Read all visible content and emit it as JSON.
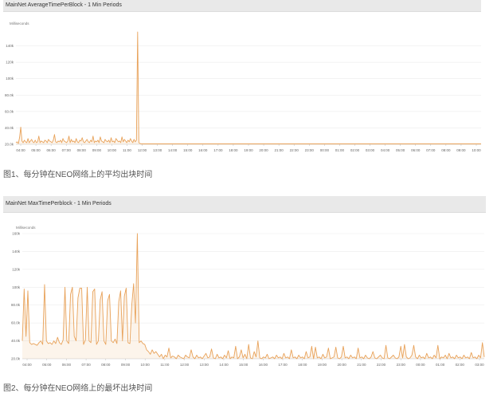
{
  "chart_data": [
    {
      "type": "line",
      "title": "MainNet AverageTimePerBlock - 1 Min Periods",
      "ylabel": "Milliseconds",
      "xlabel": "",
      "ylim": [
        20000,
        160000
      ],
      "yticks": [
        "20.0k",
        "40.0k",
        "60.0k",
        "80.0k",
        "100k",
        "120k",
        "140k"
      ],
      "x": [
        "04:00",
        "05:00",
        "06:00",
        "07:00",
        "08:00",
        "09:00",
        "10:00",
        "11:00",
        "12:00",
        "13:00",
        "14:00",
        "15:00",
        "16:00",
        "17:00",
        "18:00",
        "19:00",
        "20:00",
        "21:00",
        "22:00",
        "23:00",
        "00:00",
        "01:00",
        "02:00",
        "03:00",
        "04:00",
        "05:00",
        "06:00",
        "07:00",
        "08:00",
        "09:00",
        "10:00"
      ],
      "grid": true,
      "color": "#e8a25a",
      "series": [
        {
          "values": [
            22000,
            23000,
            21000,
            28000,
            41000,
            24000,
            22000,
            25000,
            23000,
            22000,
            27000,
            22000,
            24000,
            26000,
            23000,
            22000,
            25000,
            22000,
            23000,
            30000,
            22000,
            24000,
            23000,
            22000,
            25000,
            24000,
            22000,
            26000,
            24000,
            23000,
            22000,
            25000,
            32000,
            23000,
            22000,
            24000,
            23000,
            25000,
            22000,
            27000,
            24000,
            23000,
            22000,
            24000,
            30000,
            22000,
            26000,
            23000,
            24000,
            22000,
            27000,
            23000,
            22000,
            25000,
            24000,
            28000,
            23000,
            22000,
            24000,
            26000,
            23000,
            22000,
            25000,
            23000,
            30000,
            22000,
            24000,
            23000,
            25000,
            22000,
            29000,
            24000,
            23000,
            22000,
            26000,
            24000,
            23000,
            25000,
            22000,
            28000,
            23000,
            24000,
            22000,
            27000,
            25000,
            23000,
            24000,
            22000,
            29000,
            23000,
            26000,
            24000,
            22000,
            25000,
            23000,
            27000,
            24000,
            22000,
            26000,
            23000,
            25000,
            157000,
            22000,
            21000,
            20500,
            20500,
            20500,
            20500,
            20500,
            20500,
            20500,
            20500,
            20500,
            20500,
            20500,
            20500,
            20500,
            20500,
            20500,
            20500,
            20500,
            20500,
            20500,
            20500,
            20500,
            20500,
            20500,
            20500,
            20500,
            20500,
            20500,
            20500,
            20500,
            20500,
            20500,
            20500,
            20500,
            20500,
            20500,
            20500,
            20500,
            20500,
            20500,
            20500,
            20500,
            20500,
            20500,
            20500,
            20500,
            20500,
            20500,
            20500,
            20500,
            20500,
            20500,
            20500,
            20500,
            20500,
            20500,
            20500,
            20500,
            20500,
            20500,
            20500,
            20500,
            20500,
            20500,
            20500,
            20500,
            20500,
            20500,
            20500,
            20500,
            20500,
            20500,
            20500,
            20500,
            20500,
            20500,
            20500,
            20500,
            20500,
            20500,
            20500,
            20500,
            20500,
            20500,
            20500,
            20500,
            20500,
            20500,
            20500,
            20500,
            20500,
            20500,
            20500,
            20500,
            20500,
            20500,
            20500,
            20500,
            20500,
            20500,
            20500,
            20500,
            20500,
            20500,
            20500,
            20500,
            20500,
            20500,
            20500,
            20500,
            20500,
            20500,
            20500,
            20500,
            20500,
            20500,
            20500,
            20500,
            20500,
            20500,
            20500,
            20500,
            20500,
            20500,
            20500,
            20500,
            20500,
            20500,
            20500,
            20500,
            20500,
            20500,
            20500,
            20500,
            20500,
            20500,
            20500,
            20500,
            20500,
            20500,
            20500,
            20500,
            20500,
            20500,
            20500,
            20500,
            20500,
            20500,
            20500,
            20500,
            20500,
            20500,
            20500,
            20500,
            20500,
            20500,
            20500,
            20500,
            20500,
            20500,
            20500,
            20500,
            20500,
            20500,
            20500,
            20500,
            20500,
            20500,
            20500,
            20500,
            20500,
            20500,
            20500,
            20500,
            20500,
            20500,
            20500,
            20500,
            20500,
            20500,
            20500,
            20500,
            20500,
            20500,
            20500,
            20500,
            20500,
            20500,
            20500,
            20500,
            20500,
            20500,
            20500,
            20500,
            20500,
            20500,
            20500,
            20500,
            20500,
            20500,
            20500,
            20500,
            20500,
            20500,
            20500,
            20500,
            20500,
            20500,
            20500,
            20500,
            20500,
            20500,
            20500,
            20500,
            20500,
            20500,
            20500,
            20500,
            20500,
            20500,
            20500,
            20500,
            20500,
            20500,
            20500,
            20500,
            20500,
            20500,
            20500,
            20500,
            20500,
            20500,
            20500,
            20500,
            20500,
            20500,
            20500,
            20500,
            20500,
            20500,
            20500,
            20500,
            20500,
            20500,
            20500,
            20500,
            20500,
            20500,
            20500,
            20500,
            20500,
            20500,
            20500,
            20500,
            20500,
            20500,
            20500,
            20500,
            20500,
            20500,
            20500,
            20500,
            20500,
            20500,
            20500,
            20500,
            20500,
            20500,
            20500,
            20500,
            20500,
            20500,
            20500,
            20500,
            20500,
            20500,
            20500,
            20500,
            20500,
            20500,
            20500,
            20500,
            20500,
            20500
          ]
        }
      ],
      "caption": "图1、每分钟在NEO网络上的平均出块时间"
    },
    {
      "type": "line",
      "title": "MainNet MaxTimePerblock - 1 Min Periods",
      "ylabel": "Milliseconds",
      "xlabel": "",
      "ylim": [
        20000,
        160000
      ],
      "yticks": [
        "20.0k",
        "40.0k",
        "60.0k",
        "80.0k",
        "100k",
        "120k",
        "140k",
        "160k"
      ],
      "x": [
        "04:00",
        "05:00",
        "06:00",
        "07:00",
        "08:00",
        "09:00",
        "10:00",
        "11:00",
        "12:00",
        "13:00",
        "14:00",
        "15:00",
        "16:00",
        "17:00",
        "18:00",
        "19:00",
        "20:00",
        "21:00",
        "22:00",
        "23:00",
        "00:00",
        "01:00",
        "02:00",
        "03:00"
      ],
      "grid": true,
      "color": "#e8a25a",
      "series": [
        {
          "values": [
            40000,
            98000,
            45000,
            96000,
            38000,
            36000,
            37000,
            36000,
            35000,
            38000,
            40000,
            36000,
            103000,
            40000,
            37000,
            38000,
            36000,
            40000,
            37000,
            44000,
            38000,
            36000,
            41000,
            100000,
            40000,
            37000,
            92000,
            100000,
            45000,
            40000,
            88000,
            99000,
            99000,
            36000,
            41000,
            100000,
            40000,
            38000,
            95000,
            98000,
            36000,
            40000,
            86000,
            95000,
            40000,
            36000,
            85000,
            92000,
            40000,
            38000,
            42000,
            37000,
            84000,
            96000,
            40000,
            90000,
            99000,
            38000,
            37000,
            80000,
            104000,
            60000,
            160000,
            38000,
            40000,
            37000,
            36000,
            30000,
            28000,
            25000,
            30000,
            26000,
            28000,
            25000,
            22000,
            25000,
            20000,
            24000,
            22000,
            32000,
            21000,
            23000,
            22000,
            20000,
            24000,
            22000,
            21000,
            20000,
            24000,
            22000,
            21000,
            30000,
            22000,
            20000,
            24000,
            21000,
            22000,
            20000,
            23000,
            26000,
            21000,
            22000,
            31000,
            21000,
            20000,
            25000,
            21000,
            22000,
            20000,
            24000,
            21000,
            29000,
            20000,
            22000,
            21000,
            34000,
            20000,
            22000,
            30000,
            21000,
            25000,
            20000,
            36000,
            21000,
            20000,
            28000,
            22000,
            40000,
            21000,
            20000,
            22000,
            21000,
            25000,
            20000,
            21000,
            22000,
            20000,
            24000,
            21000,
            22000,
            20000,
            26000,
            21000,
            22000,
            20000,
            30000,
            21000,
            22000,
            20000,
            24000,
            21000,
            22000,
            20000,
            28000,
            21000,
            22000,
            34000,
            20000,
            33000,
            21000,
            22000,
            20000,
            25000,
            21000,
            22000,
            32000,
            20000,
            21000,
            22000,
            33000,
            21000,
            20000,
            22000,
            34000,
            21000,
            22000,
            20000,
            24000,
            21000,
            22000,
            20000,
            32000,
            21000,
            22000,
            20000,
            24000,
            21000,
            20000,
            22000,
            28000,
            21000,
            20000,
            22000,
            24000,
            21000,
            20000,
            35000,
            21000,
            20000,
            22000,
            24000,
            21000,
            20000,
            22000,
            34000,
            21000,
            36000,
            22000,
            20000,
            21000,
            24000,
            35000,
            22000,
            20000,
            24000,
            21000,
            22000,
            20000,
            26000,
            21000,
            22000,
            20000,
            24000,
            21000,
            35000,
            20000,
            22000,
            21000,
            24000,
            20000,
            26000,
            21000,
            22000,
            20000,
            24000,
            21000,
            22000,
            20000,
            24000,
            21000,
            22000,
            20000,
            27000,
            21000,
            22000,
            20000,
            24000,
            21000,
            38000,
            22000
          ]
        }
      ],
      "caption": "图2、每分钟在NEO网络上的最坏出块时间"
    }
  ],
  "captions": {
    "fig1": "图1、每分钟在NEO网络上的平均出块时间",
    "fig2": "图2、每分钟在NEO网络上的最坏出块时间"
  }
}
